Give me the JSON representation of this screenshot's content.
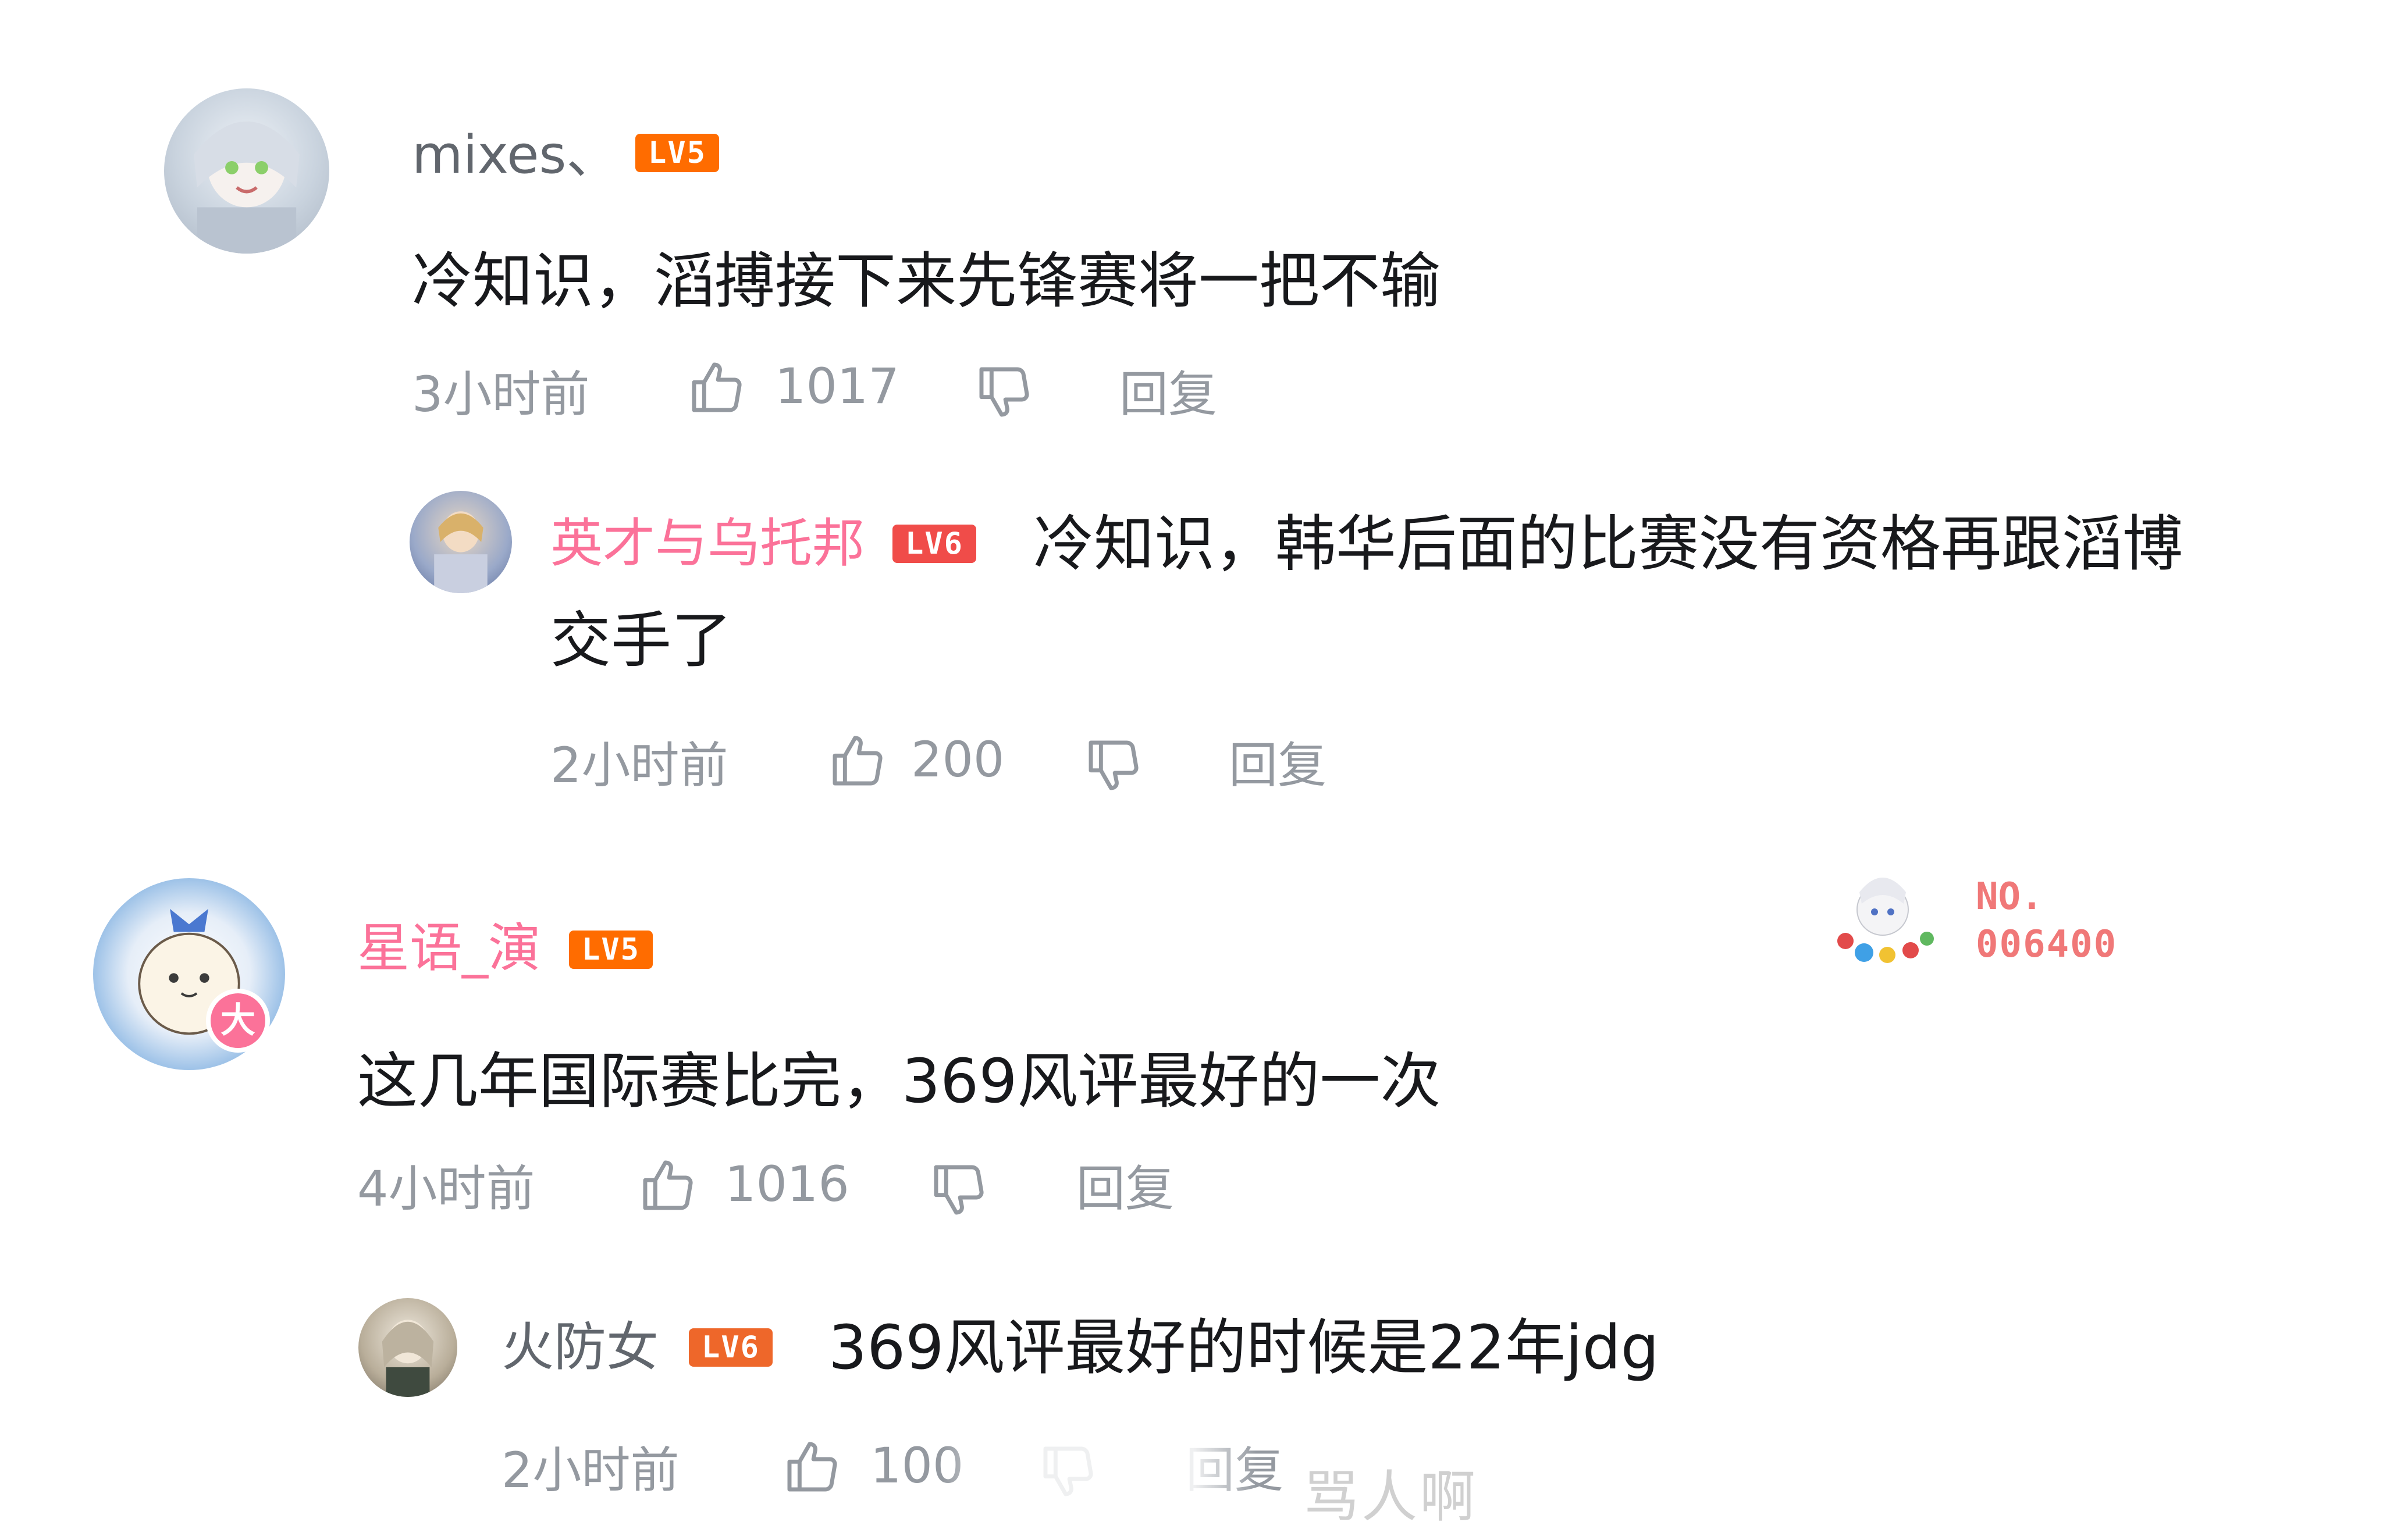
{
  "comments": [
    {
      "user": "mixes、",
      "level": "LV5",
      "text": "冷知识，滔搏接下来先锋赛将一把不输",
      "time": "3小时前",
      "likes": "1017",
      "reply_label": "回复",
      "replies": [
        {
          "user": "英才与乌托邦",
          "level": "LV6",
          "text": "冷知识，韩华后面的比赛没有资格再跟滔博交手了",
          "time": "2小时前",
          "likes": "200",
          "reply_label": "回复"
        }
      ]
    },
    {
      "user": "星语_演",
      "level": "LV5",
      "avatar_badge": "大",
      "text": "这几年国际赛比完，369风评最好的一次",
      "time": "4小时前",
      "likes": "1016",
      "reply_label": "回复",
      "fan_badge": {
        "line1": "NO.",
        "line2": "006400"
      },
      "replies": [
        {
          "user": "火防女",
          "level": "LV6",
          "text": "369风评最好的时候是22年jdg",
          "time": "2小时前",
          "likes": "100",
          "reply_label": "回复"
        }
      ]
    }
  ],
  "watermark": "骂人啊",
  "colors": {
    "pink_name": "#fb7299",
    "level5": "#ff6c00",
    "level6": "#ee672a",
    "meta": "#9499a0"
  }
}
